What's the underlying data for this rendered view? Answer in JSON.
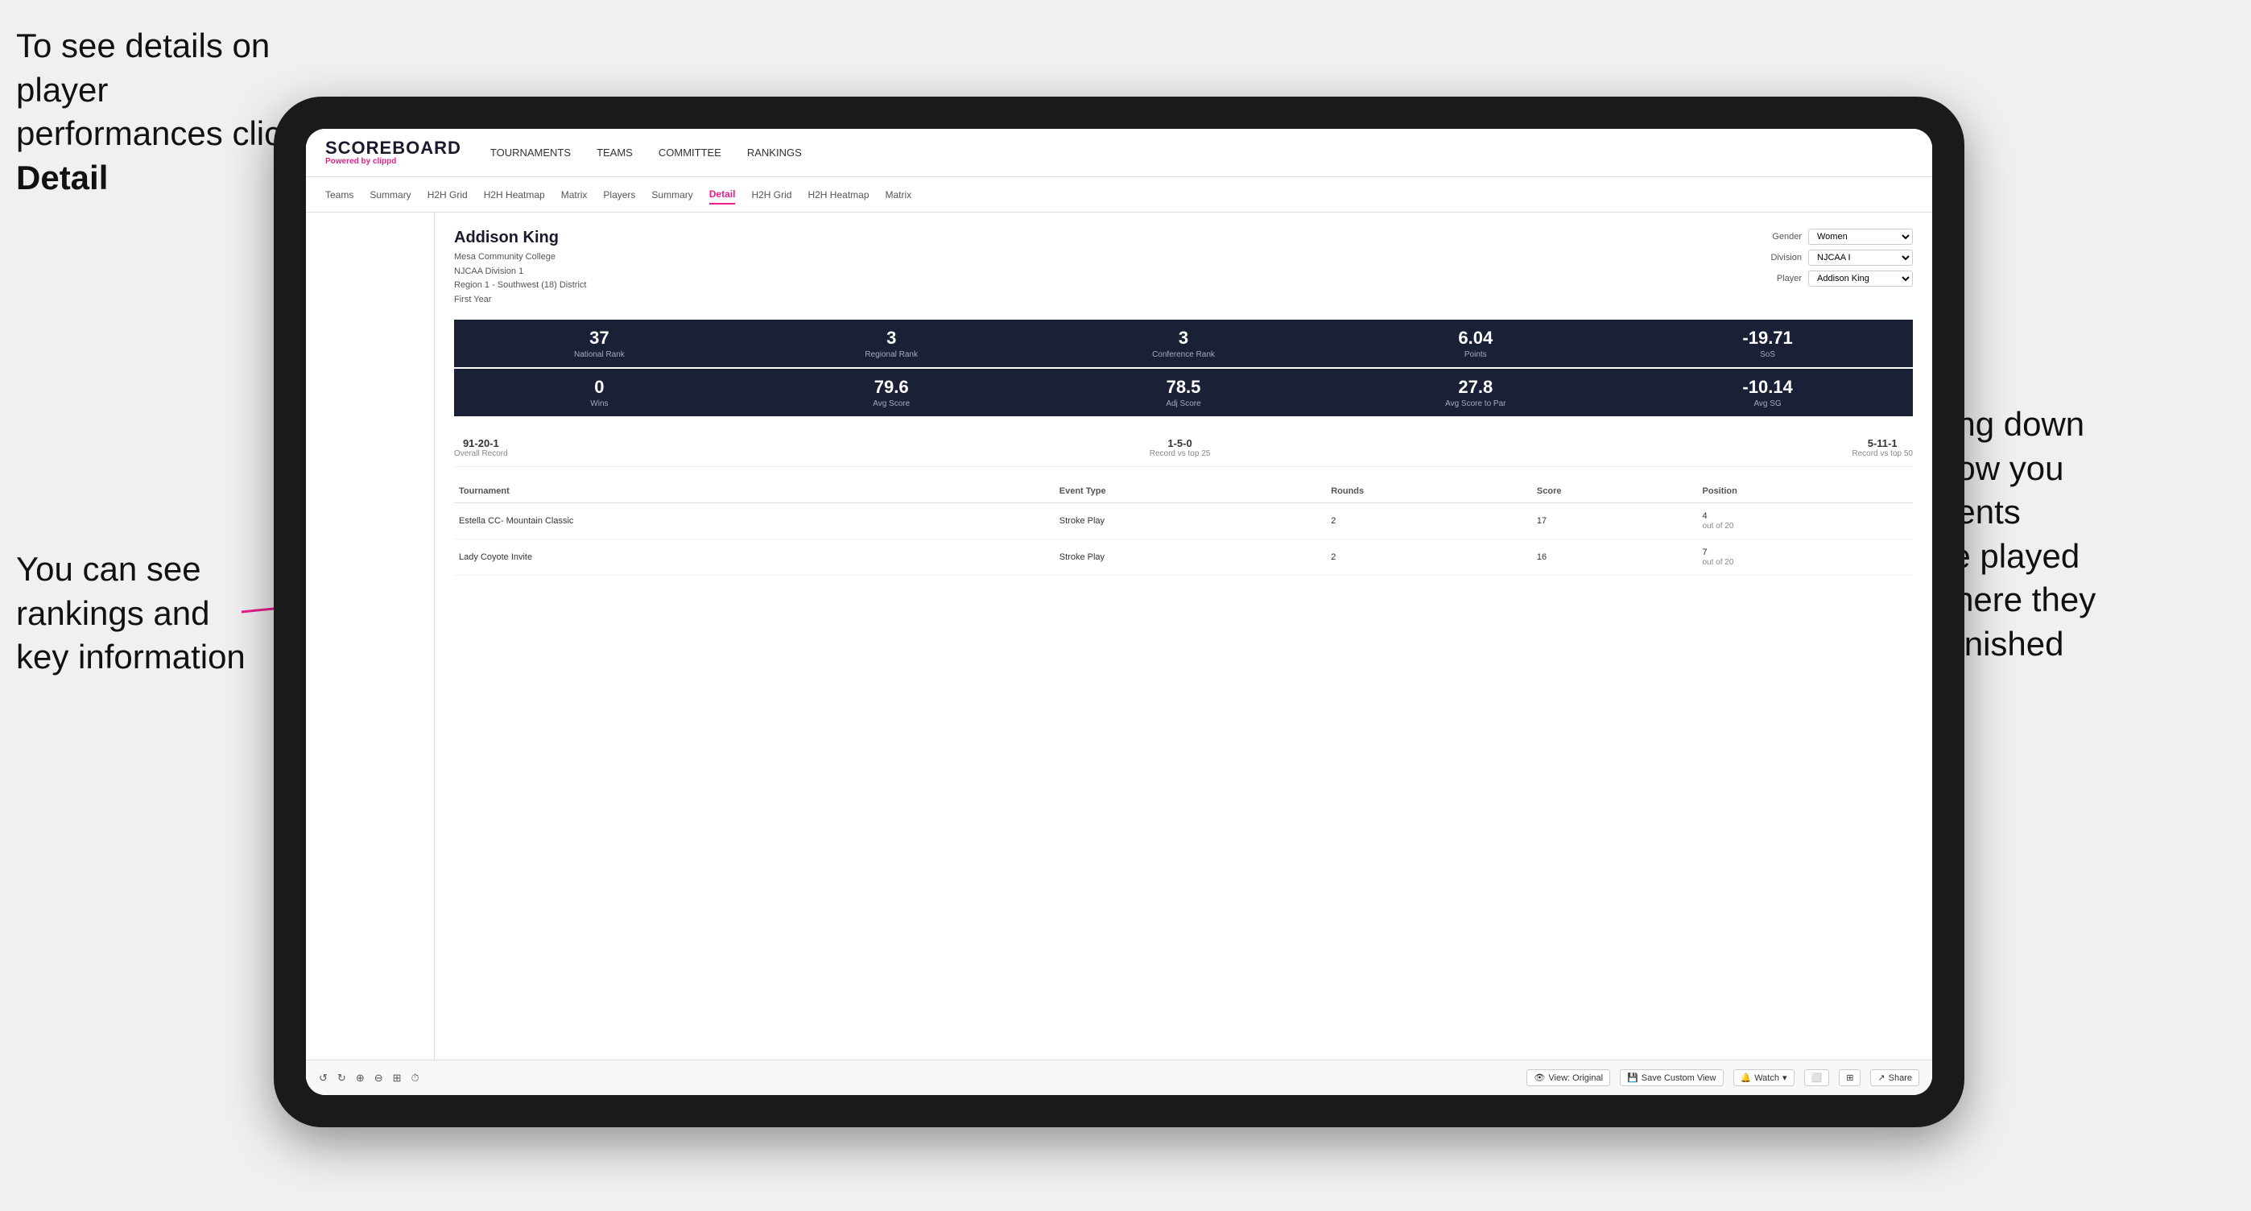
{
  "annotations": {
    "top_left": "To see details on player performances click ",
    "top_left_bold": "Detail",
    "bottom_left_line1": "You can see",
    "bottom_left_line2": "rankings and",
    "bottom_left_line3": "key information",
    "right_line1": "Scrolling down",
    "right_line2": "will show you",
    "right_line3": "the events",
    "right_line4": "they've played",
    "right_line5": "and where they",
    "right_line6": "have finished"
  },
  "nav": {
    "logo": "SCOREBOARD",
    "powered_by": "Powered by ",
    "powered_brand": "clippd",
    "items": [
      "TOURNAMENTS",
      "TEAMS",
      "COMMITTEE",
      "RANKINGS"
    ]
  },
  "secondary_tabs": [
    "Teams",
    "Summary",
    "H2H Grid",
    "H2H Heatmap",
    "Matrix",
    "Players",
    "Summary",
    "Detail",
    "H2H Grid",
    "H2H Heatmap",
    "Matrix"
  ],
  "active_tab": "Detail",
  "player": {
    "name": "Addison King",
    "school": "Mesa Community College",
    "division": "NJCAA Division 1",
    "region": "Region 1 - Southwest (18) District",
    "year": "First Year"
  },
  "filters": {
    "gender_label": "Gender",
    "gender_value": "Women",
    "division_label": "Division",
    "division_value": "NJCAA I",
    "player_label": "Player",
    "player_value": "Addison King"
  },
  "stats_row1": [
    {
      "value": "37",
      "label": "National Rank"
    },
    {
      "value": "3",
      "label": "Regional Rank"
    },
    {
      "value": "3",
      "label": "Conference Rank"
    },
    {
      "value": "6.04",
      "label": "Points"
    },
    {
      "value": "-19.71",
      "label": "SoS"
    }
  ],
  "stats_row2": [
    {
      "value": "0",
      "label": "Wins"
    },
    {
      "value": "79.6",
      "label": "Avg Score"
    },
    {
      "value": "78.5",
      "label": "Adj Score"
    },
    {
      "value": "27.8",
      "label": "Avg Score to Par"
    },
    {
      "value": "-10.14",
      "label": "Avg SG"
    }
  ],
  "records": [
    {
      "value": "91-20-1",
      "label": "Overall Record"
    },
    {
      "value": "1-5-0",
      "label": "Record vs top 25"
    },
    {
      "value": "5-11-1",
      "label": "Record vs top 50"
    }
  ],
  "table": {
    "headers": [
      "Tournament",
      "",
      "Event Type",
      "Rounds",
      "Score",
      "Position"
    ],
    "rows": [
      {
        "tournament": "Estella CC- Mountain Classic",
        "event_type": "Stroke Play",
        "rounds": "2",
        "score": "17",
        "position": "4",
        "position_detail": "out of 20"
      },
      {
        "tournament": "Lady Coyote Invite",
        "event_type": "Stroke Play",
        "rounds": "2",
        "score": "16",
        "position": "7",
        "position_detail": "out of 20"
      }
    ]
  },
  "toolbar": {
    "undo": "↺",
    "redo": "↻",
    "view_original": "View: Original",
    "save_custom": "Save Custom View",
    "watch": "Watch",
    "share": "Share"
  },
  "colors": {
    "accent": "#e91e8c",
    "dark_navy": "#1a2035",
    "text_dark": "#1a1a2e"
  }
}
